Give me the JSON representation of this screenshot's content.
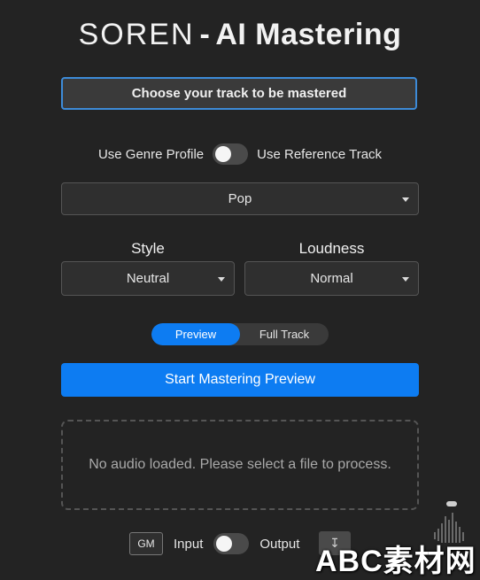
{
  "header": {
    "brand": "SOREN",
    "separator": "-",
    "subtitle": "AI Mastering"
  },
  "file_picker": {
    "label": "Choose your track to be mastered"
  },
  "mode_toggle": {
    "left_label": "Use Genre Profile",
    "right_label": "Use Reference Track",
    "on": false
  },
  "genre": {
    "selected": "Pop"
  },
  "style": {
    "label": "Style",
    "selected": "Neutral"
  },
  "loudness": {
    "label": "Loudness",
    "selected": "Normal"
  },
  "render_mode": {
    "options": [
      "Preview",
      "Full Track"
    ],
    "active": "Preview"
  },
  "start_button": {
    "label": "Start Mastering Preview"
  },
  "dropzone": {
    "message": "No audio loaded. Please select a file to process."
  },
  "monitor": {
    "gm_label": "GM",
    "input_label": "Input",
    "output_label": "Output",
    "on": false
  },
  "download": {
    "icon": "download-icon"
  },
  "watermark": {
    "text": "ABC素材网"
  },
  "colors": {
    "accent": "#0d7cf2",
    "background": "#232323",
    "focus_border": "#3d8bd8"
  }
}
